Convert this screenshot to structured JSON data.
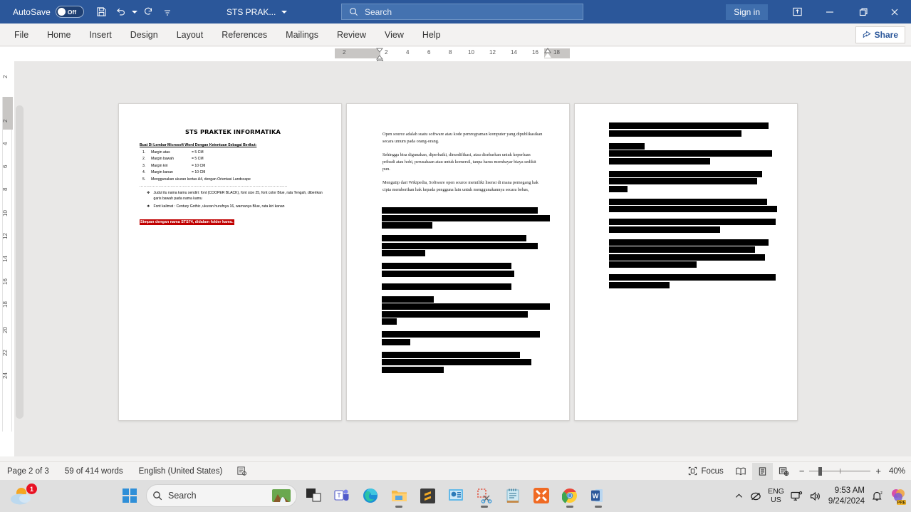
{
  "titlebar": {
    "autosave_label": "AutoSave",
    "autosave_state": "Off",
    "quick_access": [
      {
        "name": "save-icon",
        "tip": "Save"
      },
      {
        "name": "undo-icon",
        "tip": "Undo"
      },
      {
        "name": "redo-icon",
        "tip": "Redo"
      },
      {
        "name": "customize-quick-access-icon",
        "tip": "Customize Quick Access Toolbar"
      }
    ],
    "document_title": "STS PRAK...",
    "search_placeholder": "Search",
    "sign_in": "Sign in",
    "window_buttons": [
      "ribbon-display-options",
      "minimize",
      "restore",
      "close"
    ],
    "accent_color": "#2b579a"
  },
  "ribbon": {
    "tabs": [
      {
        "label": "File"
      },
      {
        "label": "Home"
      },
      {
        "label": "Insert"
      },
      {
        "label": "Design"
      },
      {
        "label": "Layout"
      },
      {
        "label": "References"
      },
      {
        "label": "Mailings"
      },
      {
        "label": "Review"
      },
      {
        "label": "View"
      },
      {
        "label": "Help"
      }
    ],
    "share_label": "Share"
  },
  "rulers": {
    "corner_label": "L",
    "horizontal": [
      "2",
      "2",
      "4",
      "6",
      "8",
      "10",
      "12",
      "14",
      "16",
      "18"
    ],
    "vertical": [
      "2",
      "2",
      "4",
      "6",
      "8",
      "10",
      "12",
      "14",
      "16",
      "18",
      "20",
      "22",
      "24"
    ]
  },
  "document": {
    "page1": {
      "title": "STS PRAKTEK INFORMATIKA",
      "subtitle": "Buat Di Lembar Microsoft Word Dengan Ketentuan Sebagai Berikut:",
      "numbered": [
        {
          "n": "1.",
          "key": "Margin atas",
          "val": "= 5 CM"
        },
        {
          "n": "2.",
          "key": "Margin bawah",
          "val": "= 5 CM"
        },
        {
          "n": "3.",
          "key": "Margin kiri",
          "val": "= 10 CM"
        },
        {
          "n": "4.",
          "key": "Margin kanan",
          "val": "= 10 CM"
        },
        {
          "n": "5.",
          "key": "Menggunakan ukuran kertas A4, dengan Orientasi Landscape",
          "val": ""
        }
      ],
      "divider": "..............................................................................................................",
      "bullets": [
        "Judul itu nama kamu sendiri: font (COOPER BLACK), font size 25, font color Blue, rata Tengah, diberikan garis bawah pada nama kamu",
        "Font kalimat    : Century Gothic, ukuran hurufnya 16, warnanya Blue, rata kiri kanan"
      ],
      "highlight": "Simpan dengan nama STS74, didalam folder kamu.",
      "highlight_color": "#c00000"
    },
    "page2": {
      "paragraphs": [
        "Open source adalah suatu software atau kode pemrograman komputer yang dipublikasikan secara umum pada orang-orang.",
        "Sehingga bisa digunakan, diperbaiki, dimodifikasi, atau disebarkan untuk keperluan pribadi atau hobi, perusahaan atau untuk komersil, tanpa harus membayar biaya sedikit pun.",
        "Mengutip dari Wikipedia, Software open source memiliki lisensi di mana pemegang hak cipta memberikan hak kepada pengguna lain untuk menggunakannya secara bebas,"
      ],
      "redacted_blocks": [
        [
          93,
          100,
          30
        ],
        [
          86,
          93,
          26
        ],
        [
          77,
          79
        ],
        [
          77
        ],
        [
          31,
          100,
          87,
          9
        ],
        [
          94,
          17
        ],
        [
          82,
          89,
          37
        ]
      ]
    },
    "page3": {
      "redacted_blocks": [
        [
          95,
          79
        ],
        [
          21,
          97,
          60
        ],
        [
          91,
          88,
          11
        ],
        [
          94,
          100
        ],
        [
          99,
          66
        ],
        [
          95,
          87,
          93,
          52
        ],
        [
          99,
          36
        ]
      ]
    }
  },
  "statusbar": {
    "page_indicator": "Page 2 of 3",
    "word_count": "59 of 414 words",
    "language": "English (United States)",
    "proofing_icon": "editor-proofing-icon",
    "focus_label": "Focus",
    "view_buttons": [
      {
        "name": "read-mode-button"
      },
      {
        "name": "print-layout-button",
        "active": true
      },
      {
        "name": "web-layout-button"
      }
    ],
    "zoom_out": "−",
    "zoom_in": "+",
    "zoom_level": "40%"
  },
  "taskbar": {
    "weather_badge": "1",
    "search_placeholder": "Search",
    "apps": [
      {
        "name": "task-view-icon"
      },
      {
        "name": "microsoft-teams-icon"
      },
      {
        "name": "microsoft-edge-icon"
      },
      {
        "name": "file-explorer-icon"
      },
      {
        "name": "sublime-text-icon"
      },
      {
        "name": "powerpoint-icon"
      },
      {
        "name": "snipping-tool-icon"
      },
      {
        "name": "notepad-icon"
      },
      {
        "name": "xampp-icon"
      },
      {
        "name": "google-chrome-icon"
      },
      {
        "name": "microsoft-word-icon"
      }
    ],
    "tray": {
      "language_line1": "ENG",
      "language_line2": "US",
      "time": "9:53 AM",
      "date": "9/24/2024"
    }
  }
}
